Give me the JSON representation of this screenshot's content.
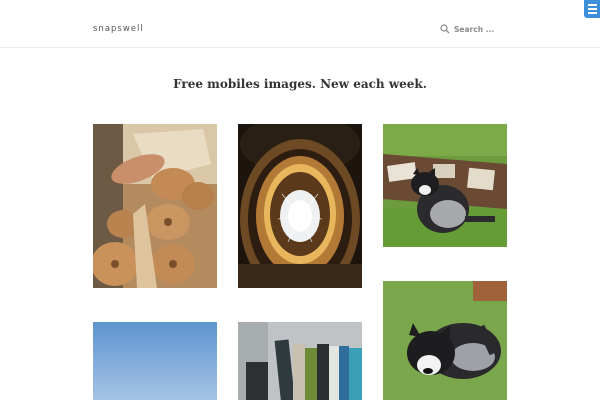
{
  "site": {
    "logo": "snapswell"
  },
  "search": {
    "placeholder": "Search ..."
  },
  "hero": {
    "tagline": "Free mobiles images. New each week."
  },
  "icons": {
    "search": "search-icon",
    "menu": "menu-icon"
  },
  "colors": {
    "accent": "#3d8fdc",
    "header_border": "#ececec",
    "text": "#333333"
  },
  "gallery": [
    {
      "subject": "pastries"
    },
    {
      "subject": "ceiling-light"
    },
    {
      "subject": "dog-on-lawn"
    },
    {
      "subject": "dog-close-up"
    },
    {
      "subject": "blue-sky"
    },
    {
      "subject": "books"
    }
  ]
}
